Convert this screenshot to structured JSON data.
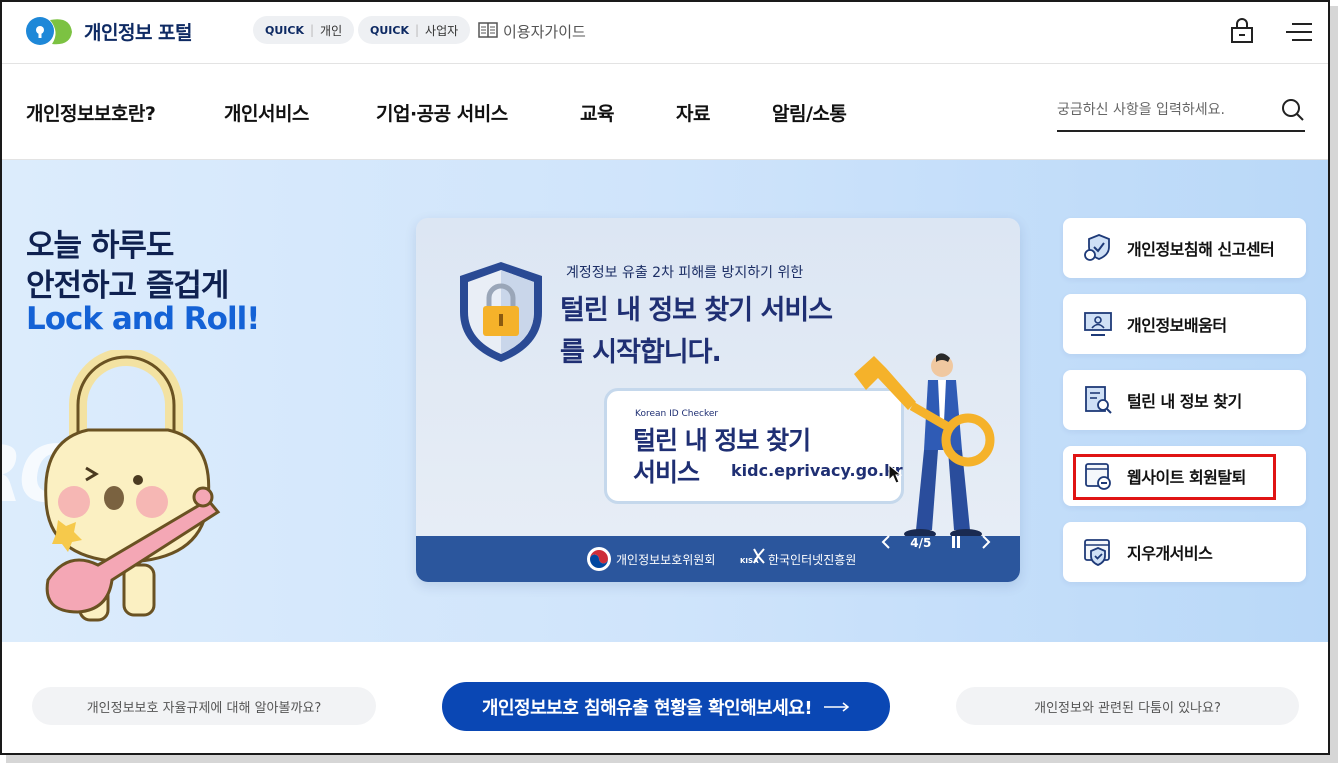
{
  "header": {
    "site_title": "개인정보 포털",
    "quick_personal": {
      "tag": "QUICK",
      "label": "개인"
    },
    "quick_business": {
      "tag": "QUICK",
      "label": "사업자"
    },
    "guide_label": "이용자가이드"
  },
  "nav": {
    "items": [
      "개인정보보호란?",
      "개인서비스",
      "기업·공공 서비스",
      "교육",
      "자료",
      "알림/소통"
    ],
    "search_placeholder": "궁금하신 사항을 입력하세요."
  },
  "hero": {
    "line1": "오늘 하루도",
    "line2": "안전하고 즐겁게",
    "line3": "Lock and Roll!",
    "bg_text": "ROLL"
  },
  "banner": {
    "subtitle": "계정정보 유출 2차 피해를 방지하기 위한",
    "title1": "털린 내 정보 찾기 서비스",
    "title2": "를 시작합니다.",
    "card_tag": "Korean ID Checker",
    "card_title1": "털린 내 정보 찾기",
    "card_title2": "서비스",
    "card_url": "kidc.eprivacy.go.kr",
    "org1": "개인정보보호위원회",
    "org2": "한국인터넷진흥원",
    "org2_prefix": "KISA",
    "page_indicator": "4/5"
  },
  "services": [
    {
      "label": "개인정보침해 신고센터",
      "icon": "report-center-icon"
    },
    {
      "label": "개인정보배움터",
      "icon": "learning-monitor-icon"
    },
    {
      "label": "털린 내 정보 찾기",
      "icon": "document-search-icon"
    },
    {
      "label": "웹사이트 회원탈퇴",
      "icon": "website-withdraw-icon"
    },
    {
      "label": "지우개서비스",
      "icon": "eraser-shield-icon"
    }
  ],
  "bottom": {
    "left_pill": "개인정보보호 자율규제에 대해 알아볼까요?",
    "cta": "개인정보보호 침해유출 현황을 확인해보세요!",
    "right_pill": "개인정보와 관련된 다툼이 있나요?"
  },
  "colors": {
    "brand_navy": "#0e2a63",
    "cta_blue": "#0a47b4",
    "hero_blue": "#1462d6",
    "highlight_red": "#e01414"
  }
}
